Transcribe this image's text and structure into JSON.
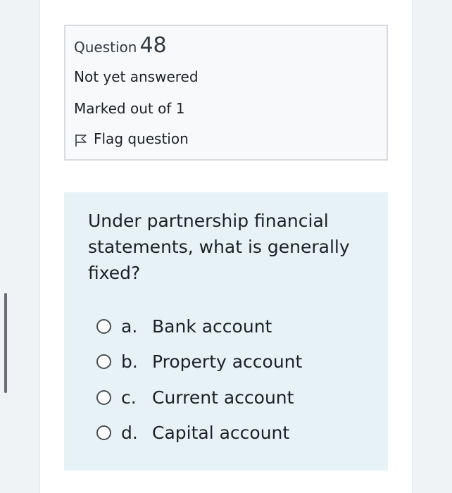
{
  "question_info": {
    "label": "Question",
    "number": "48",
    "status": "Not yet answered",
    "marks": "Marked out of 1",
    "flag_label": "Flag question",
    "flag_icon": "flag-outline-icon"
  },
  "question": {
    "text": "Under partnership financial statements, what is generally fixed?",
    "answers": [
      {
        "letter": "a.",
        "text": "Bank account"
      },
      {
        "letter": "b.",
        "text": "Property account"
      },
      {
        "letter": "c.",
        "text": "Current account"
      },
      {
        "letter": "d.",
        "text": "Capital account"
      }
    ]
  },
  "colors": {
    "page_background": "#f0f3f6",
    "question_background": "#e7f2f6",
    "info_background": "#f8f9fa",
    "info_border": "#d8dbe0"
  }
}
